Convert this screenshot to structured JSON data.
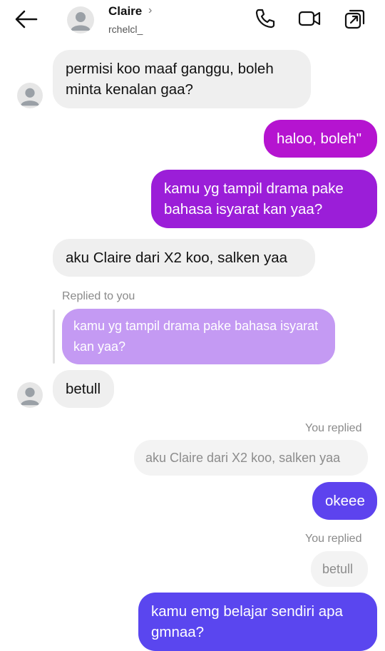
{
  "header": {
    "name": "Claire",
    "username": "rchelcl_",
    "chevron": "›",
    "icons": [
      "back-arrow-icon",
      "phone-icon",
      "video-icon",
      "share-icon"
    ]
  },
  "messages": [
    {
      "from": "them",
      "text": "permisi koo maaf ganggu, boleh minta kenalan gaa?"
    },
    {
      "from": "me",
      "text": "haloo, boleh\"",
      "color": "#b514d0"
    },
    {
      "from": "me",
      "text": "kamu yg tampil drama pake bahasa isyarat kan yaa?",
      "color": "#9b1ed8"
    },
    {
      "from": "them",
      "text": "aku Claire dari X2 koo, salken yaa"
    },
    {
      "from": "them",
      "reply_label": "Replied to you",
      "quoted": "kamu yg tampil drama pake bahasa isyarat kan yaa?",
      "text": "betull"
    },
    {
      "from": "me",
      "reply_label": "You replied",
      "quoted": "aku Claire dari X2 koo, salken yaa",
      "text": "okeee",
      "color": "#5d43ee"
    },
    {
      "from": "me",
      "reply_label": "You replied",
      "quoted": "betull",
      "text": "kamu emg belajar sendiri apa gmnaa?",
      "color": "#5a46ef"
    }
  ]
}
